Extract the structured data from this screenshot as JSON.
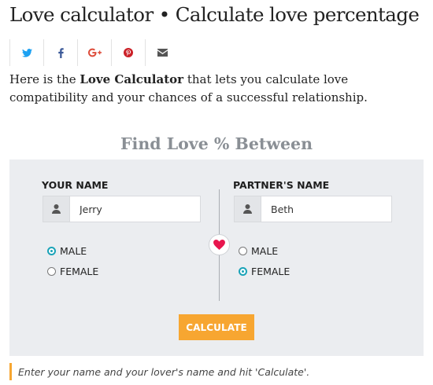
{
  "page": {
    "title": "Love calculator • Calculate love percentage",
    "intro_pre": "Here is the ",
    "intro_bold": "Love Calculator",
    "intro_post": " that lets you calculate love compatibility and your chances of a successful relationship."
  },
  "share": {
    "icons": [
      "twitter-icon",
      "facebook-icon",
      "google-plus-icon",
      "pinterest-icon",
      "email-icon"
    ],
    "colors": {
      "twitter": "#1da1f2",
      "facebook": "#3b5998",
      "google_plus": "#dd4b39",
      "pinterest": "#cb2027",
      "email": "#555555"
    }
  },
  "calculator": {
    "heading": "Find Love % Between",
    "your_name_label": "YOUR NAME",
    "your_name_value": "Jerry",
    "partner_name_label": "PARTNER'S NAME",
    "partner_name_value": "Beth",
    "your_gender": {
      "male": "MALE",
      "female": "FEMALE",
      "selected": "MALE"
    },
    "partner_gender": {
      "male": "MALE",
      "female": "FEMALE",
      "selected": "FEMALE"
    },
    "button_label": "CALCULATE",
    "note": "Enter your name and your lover's name and hit 'Calculate'."
  },
  "colors": {
    "accent": "#f7a631",
    "radio": "#1aa3b8",
    "heart": "#e8164e",
    "panel_bg": "#ebedf0"
  }
}
